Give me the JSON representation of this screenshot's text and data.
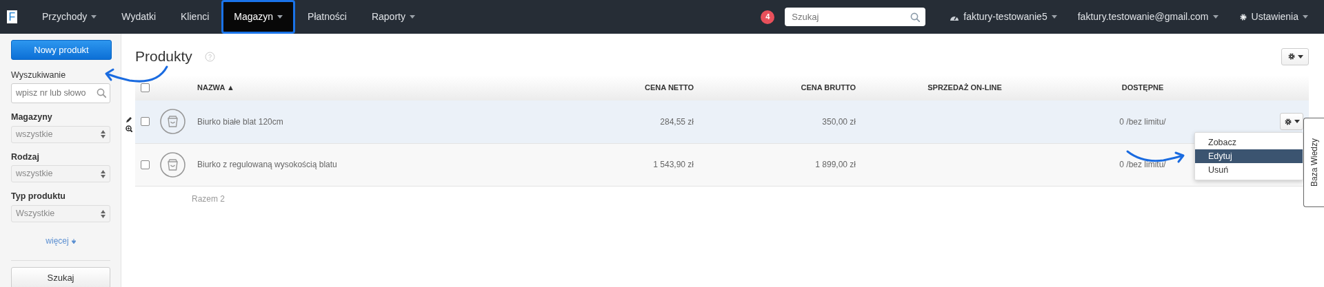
{
  "navbar": {
    "logo": "F",
    "items": [
      {
        "label": "Przychody",
        "caret": true,
        "selected": false
      },
      {
        "label": "Wydatki",
        "caret": false,
        "selected": false
      },
      {
        "label": "Klienci",
        "caret": false,
        "selected": false
      },
      {
        "label": "Magazyn",
        "caret": true,
        "selected": true
      },
      {
        "label": "Płatności",
        "caret": false,
        "selected": false
      },
      {
        "label": "Raporty",
        "caret": true,
        "selected": false
      }
    ],
    "notification_count": "4",
    "search": {
      "placeholder": "Szukaj"
    },
    "menus": [
      {
        "kind": "dashboard",
        "label": "faktury-testowanie5"
      },
      {
        "kind": "plain",
        "label": "faktury.testowanie@gmail.com"
      },
      {
        "kind": "settings",
        "label": "Ustawienia"
      }
    ]
  },
  "sidebar": {
    "new_button": "Nowy produkt",
    "search_label": "Wyszukiwanie",
    "search_placeholder": "wpisz nr lub słowo",
    "filters": [
      {
        "label": "Magazyny",
        "value": "wszystkie"
      },
      {
        "label": "Rodzaj",
        "value": "wszystkie"
      },
      {
        "label": "Typ produktu",
        "value": "Wszystkie"
      }
    ],
    "more_link": "więcej",
    "search_button": "Szukaj"
  },
  "page": {
    "title": "Produkty",
    "table": {
      "all_checked": false,
      "columns": [
        {
          "label": "NAZWA ▲"
        },
        {
          "label": "CENA NETTO"
        },
        {
          "label": "CENA BRUTTO"
        },
        {
          "label": "SPRZEDAŻ ON-LINE"
        },
        {
          "label": "DOSTĘPNE"
        }
      ],
      "rows": [
        {
          "highlighted": true,
          "checked": false,
          "cells": [
            "Biurko białe blat 120cm",
            "284,55 zł",
            "350,00 zł",
            "",
            "0 /bez limitu/"
          ]
        },
        {
          "highlighted": false,
          "checked": false,
          "cells": [
            "Biurko z regulowaną wysokością blatu",
            "1 543,90 zł",
            "1 899,00 zł",
            "",
            "0 /bez limitu/"
          ]
        }
      ]
    },
    "total": "Razem 2",
    "row_menu": [
      {
        "label": "Zobacz",
        "selected": false
      },
      {
        "label": "Edytuj",
        "selected": true
      },
      {
        "label": "Usuń",
        "selected": false
      }
    ]
  },
  "side_tab": "Baza Wiedzy"
}
